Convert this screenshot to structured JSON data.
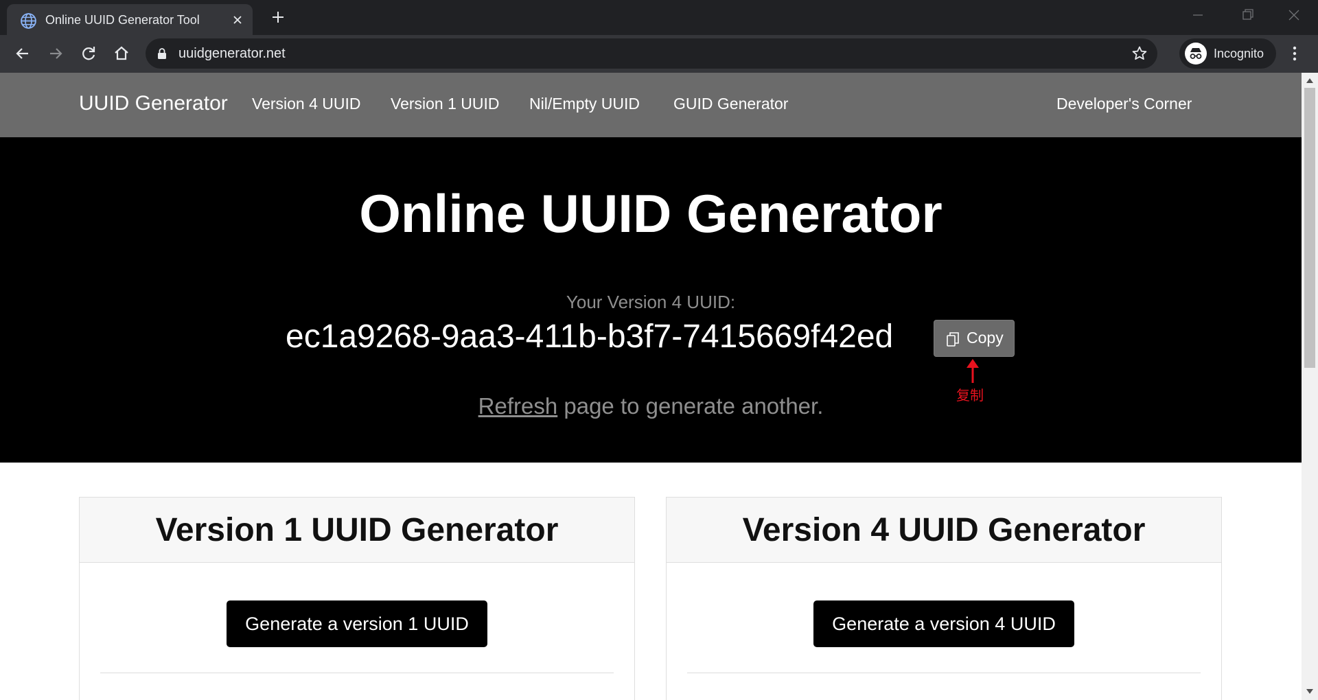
{
  "browser": {
    "tab_title": "Online UUID Generator Tool",
    "url": "uuidgenerator.net",
    "profile_label": "Incognito",
    "icons": [
      "globe-icon",
      "close-icon",
      "plus-icon",
      "back-icon",
      "forward-icon",
      "reload-icon",
      "home-icon",
      "lock-icon",
      "star-icon",
      "incognito-icon",
      "kebab-menu-icon",
      "minimize-icon",
      "restore-icon",
      "window-close-icon"
    ]
  },
  "nav": {
    "brand": "UUID Generator",
    "links": [
      "Version 4 UUID",
      "Version 1 UUID",
      "Nil/Empty UUID",
      "GUID Generator"
    ],
    "right_link": "Developer's Corner"
  },
  "hero": {
    "title": "Online UUID Generator",
    "uuid_label": "Your Version 4 UUID:",
    "uuid_value": "ec1a9268-9aa3-411b-b3f7-7415669f42ed",
    "copy_label": "Copy",
    "annotation": "复制",
    "refresh_link": "Refresh",
    "refresh_rest": " page to generate another."
  },
  "cards": [
    {
      "title": "Version 1 UUID Generator",
      "button": "Generate a version 1 UUID"
    },
    {
      "title": "Version 4 UUID Generator",
      "button": "Generate a version 4 UUID"
    }
  ],
  "colors": {
    "chrome_dark": "#202124",
    "chrome_bar": "#35363a",
    "site_nav": "#6b6b6b",
    "hero_bg": "#000000",
    "annotation_red": "#e8121e"
  }
}
